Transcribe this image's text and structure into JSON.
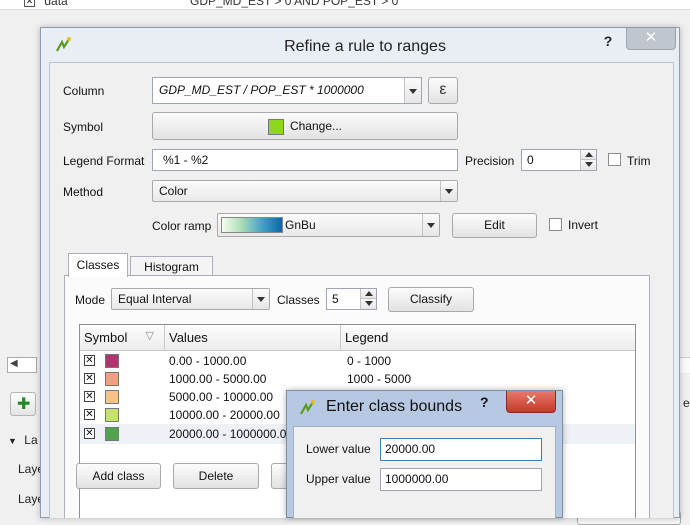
{
  "background": {
    "top_row": {
      "layer": "data",
      "rule": "GDP_MD_EST > 0 AND POP_EST > 0"
    },
    "layers_panel_label": "La",
    "layer_items": [
      "Laye",
      "Laye"
    ],
    "right_edge_text": "e"
  },
  "dialog": {
    "title": "Refine a rule to ranges",
    "help": "?",
    "close": "✕",
    "column_label": "Column",
    "column_value": "GDP_MD_EST / POP_EST * 1000000",
    "expression_button": "ε",
    "symbol_label": "Symbol",
    "symbol_button": "Change...",
    "symbol_color": "#8fd61e",
    "legend_format_label": "Legend Format",
    "legend_format_value": "%1 - %2",
    "precision_label": "Precision",
    "precision_value": "0",
    "trim_label": "Trim",
    "method_label": "Method",
    "method_value": "Color",
    "color_ramp_label": "Color ramp",
    "color_ramp_value": "GnBu",
    "edit_button": "Edit",
    "invert_label": "Invert",
    "tabs": [
      {
        "label": "Classes",
        "active": true
      },
      {
        "label": "Histogram",
        "active": false
      }
    ],
    "mode_label": "Mode",
    "mode_value": "Equal Interval",
    "classes_label": "Classes",
    "classes_value": "5",
    "classify_button": "Classify",
    "table": {
      "headers": [
        "Symbol",
        "Values",
        "Legend"
      ],
      "rows": [
        {
          "color": "#b3336f",
          "values": "0.00 - 1000.00",
          "legend": "0 - 1000"
        },
        {
          "color": "#f0a080",
          "values": "1000.00 - 5000.00",
          "legend": "1000 - 5000"
        },
        {
          "color": "#f8c387",
          "values": "5000.00 - 10000.00",
          "legend": ""
        },
        {
          "color": "#c5e36a",
          "values": "10000.00 - 20000.00",
          "legend": ""
        },
        {
          "color": "#4fa44c",
          "values": "20000.00 - 1000000.00",
          "legend": ""
        }
      ]
    },
    "add_class_button": "Add class",
    "delete_button": "Delete"
  },
  "bounds_dialog": {
    "title": "Enter class bounds",
    "help": "?",
    "close": "✕",
    "lower_label": "Lower value",
    "lower_value": "20000.00",
    "upper_label": "Upper value",
    "upper_value": "1000000.00"
  }
}
